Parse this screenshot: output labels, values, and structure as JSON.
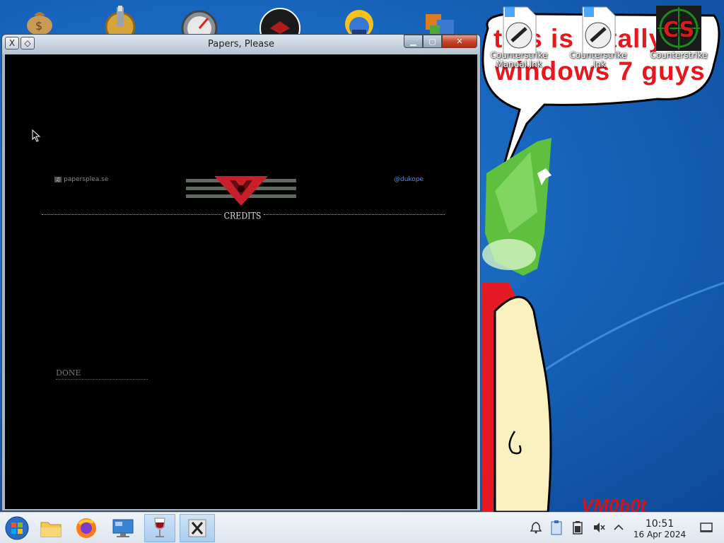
{
  "window": {
    "title": "Papers, Please"
  },
  "game": {
    "site_badge": "♫",
    "site_text": "papersplea.se",
    "twitter": "@dukope",
    "credits_label": "CREDITS",
    "done_label": "DONE"
  },
  "desktop": {
    "scribble_line1": "this is totally",
    "scribble_line2": "windows 7 guys",
    "watermark": "VM0b0t",
    "icons": [
      {
        "label": "Counterstrike Manual.lnk"
      },
      {
        "label": "Counterstrike .lnk"
      },
      {
        "label": "Counterstrike"
      }
    ],
    "top_icons": [
      "money-bag-icon",
      "gear-pump-icon",
      "speedometer-icon",
      "red-logo-icon",
      "sun-globe-icon",
      "office-chart-icon"
    ]
  },
  "taskbar": {
    "time": "10:51",
    "date": "16 Apr 2024",
    "apps": [
      "start-orb-icon",
      "file-manager-icon",
      "firefox-icon",
      "remote-desktop-icon",
      "wine-glass-icon",
      "x-window-icon"
    ],
    "tray": [
      "network-bell-icon",
      "clipboard-icon",
      "battery-icon",
      "volume-muted-icon",
      "chevron-up-icon",
      "show-desktop-icon"
    ]
  },
  "colors": {
    "accent_red": "#c8202a",
    "link_blue": "#5a8fe0",
    "titlebar": "#c9d4e0"
  }
}
